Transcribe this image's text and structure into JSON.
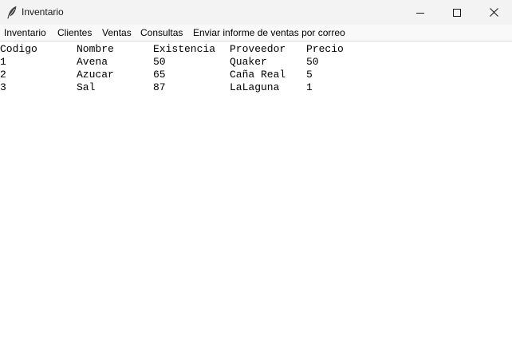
{
  "window": {
    "title": "Inventario",
    "icon": "feather-icon",
    "controls": [
      "minimize-icon",
      "maximize-icon",
      "close-icon"
    ]
  },
  "menu": {
    "items": [
      {
        "label": "Inventario"
      },
      {
        "label": "Clientes"
      },
      {
        "label": "Ventas"
      },
      {
        "label": "Consultas"
      },
      {
        "label": "Enviar informe de ventas por correo"
      }
    ]
  },
  "table": {
    "headers": [
      "Codigo",
      "Nombre",
      "Existencia",
      "Proveedor",
      "Precio"
    ],
    "rows": [
      [
        "1",
        "Avena",
        "50",
        "Quaker",
        "50"
      ],
      [
        "2",
        "Azucar",
        "65",
        "Caña Real",
        "5"
      ],
      [
        "3",
        "Sal",
        "87",
        "LaLaguna",
        "1"
      ]
    ]
  }
}
